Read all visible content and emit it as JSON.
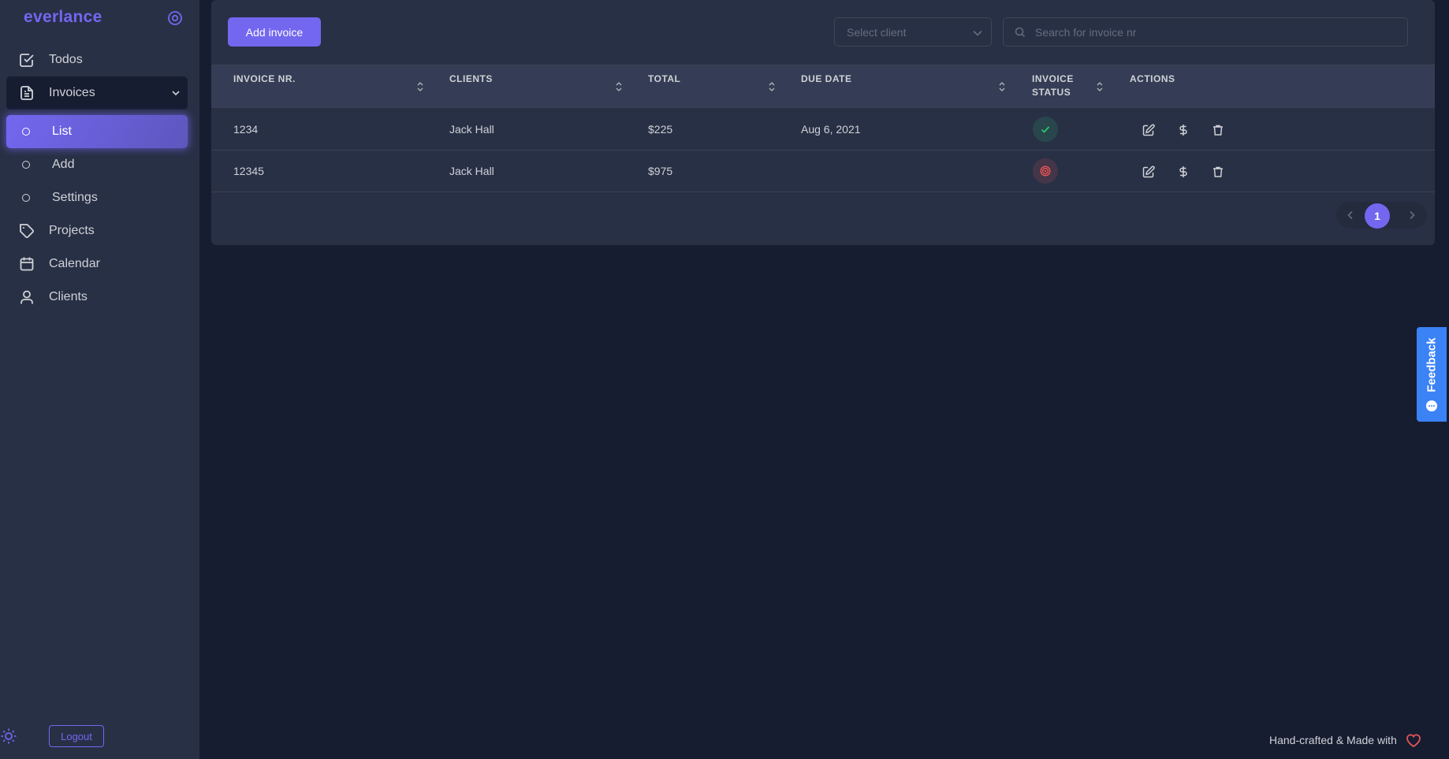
{
  "sidebar": {
    "brand": "everlance",
    "items": [
      {
        "label": "Todos",
        "icon": "check-square-icon"
      },
      {
        "label": "Invoices",
        "icon": "file-text-icon"
      },
      {
        "label": "List",
        "icon": "circle-icon"
      },
      {
        "label": "Add",
        "icon": "circle-icon"
      },
      {
        "label": "Settings",
        "icon": "circle-icon"
      },
      {
        "label": "Projects",
        "icon": "tag-icon"
      },
      {
        "label": "Calendar",
        "icon": "calendar-icon"
      },
      {
        "label": "Clients",
        "icon": "user-icon"
      }
    ],
    "logout_label": "Logout"
  },
  "toolbar": {
    "add_label": "Add invoice",
    "select_placeholder": "Select client",
    "search_placeholder": "Search for invoice nr"
  },
  "table": {
    "columns": [
      "INVOICE NR.",
      "CLIENTS",
      "TOTAL",
      "DUE DATE",
      "INVOICE",
      "STATUS",
      "ACTIONS"
    ],
    "rows": [
      {
        "nr": "1234",
        "client": "Jack Hall",
        "total": "$225",
        "due": "Aug 6, 2021",
        "status": "paid"
      },
      {
        "nr": "12345",
        "client": "Jack Hall",
        "total": "$975",
        "due": "",
        "status": "draft"
      }
    ]
  },
  "pagination": {
    "current": "1"
  },
  "feedback_label": "Feedback",
  "footer_text": "Hand-crafted & Made with",
  "colors": {
    "accent": "#7367f0",
    "success": "#28c76f",
    "danger": "#ea5455",
    "feedback": "#3b82f6"
  }
}
